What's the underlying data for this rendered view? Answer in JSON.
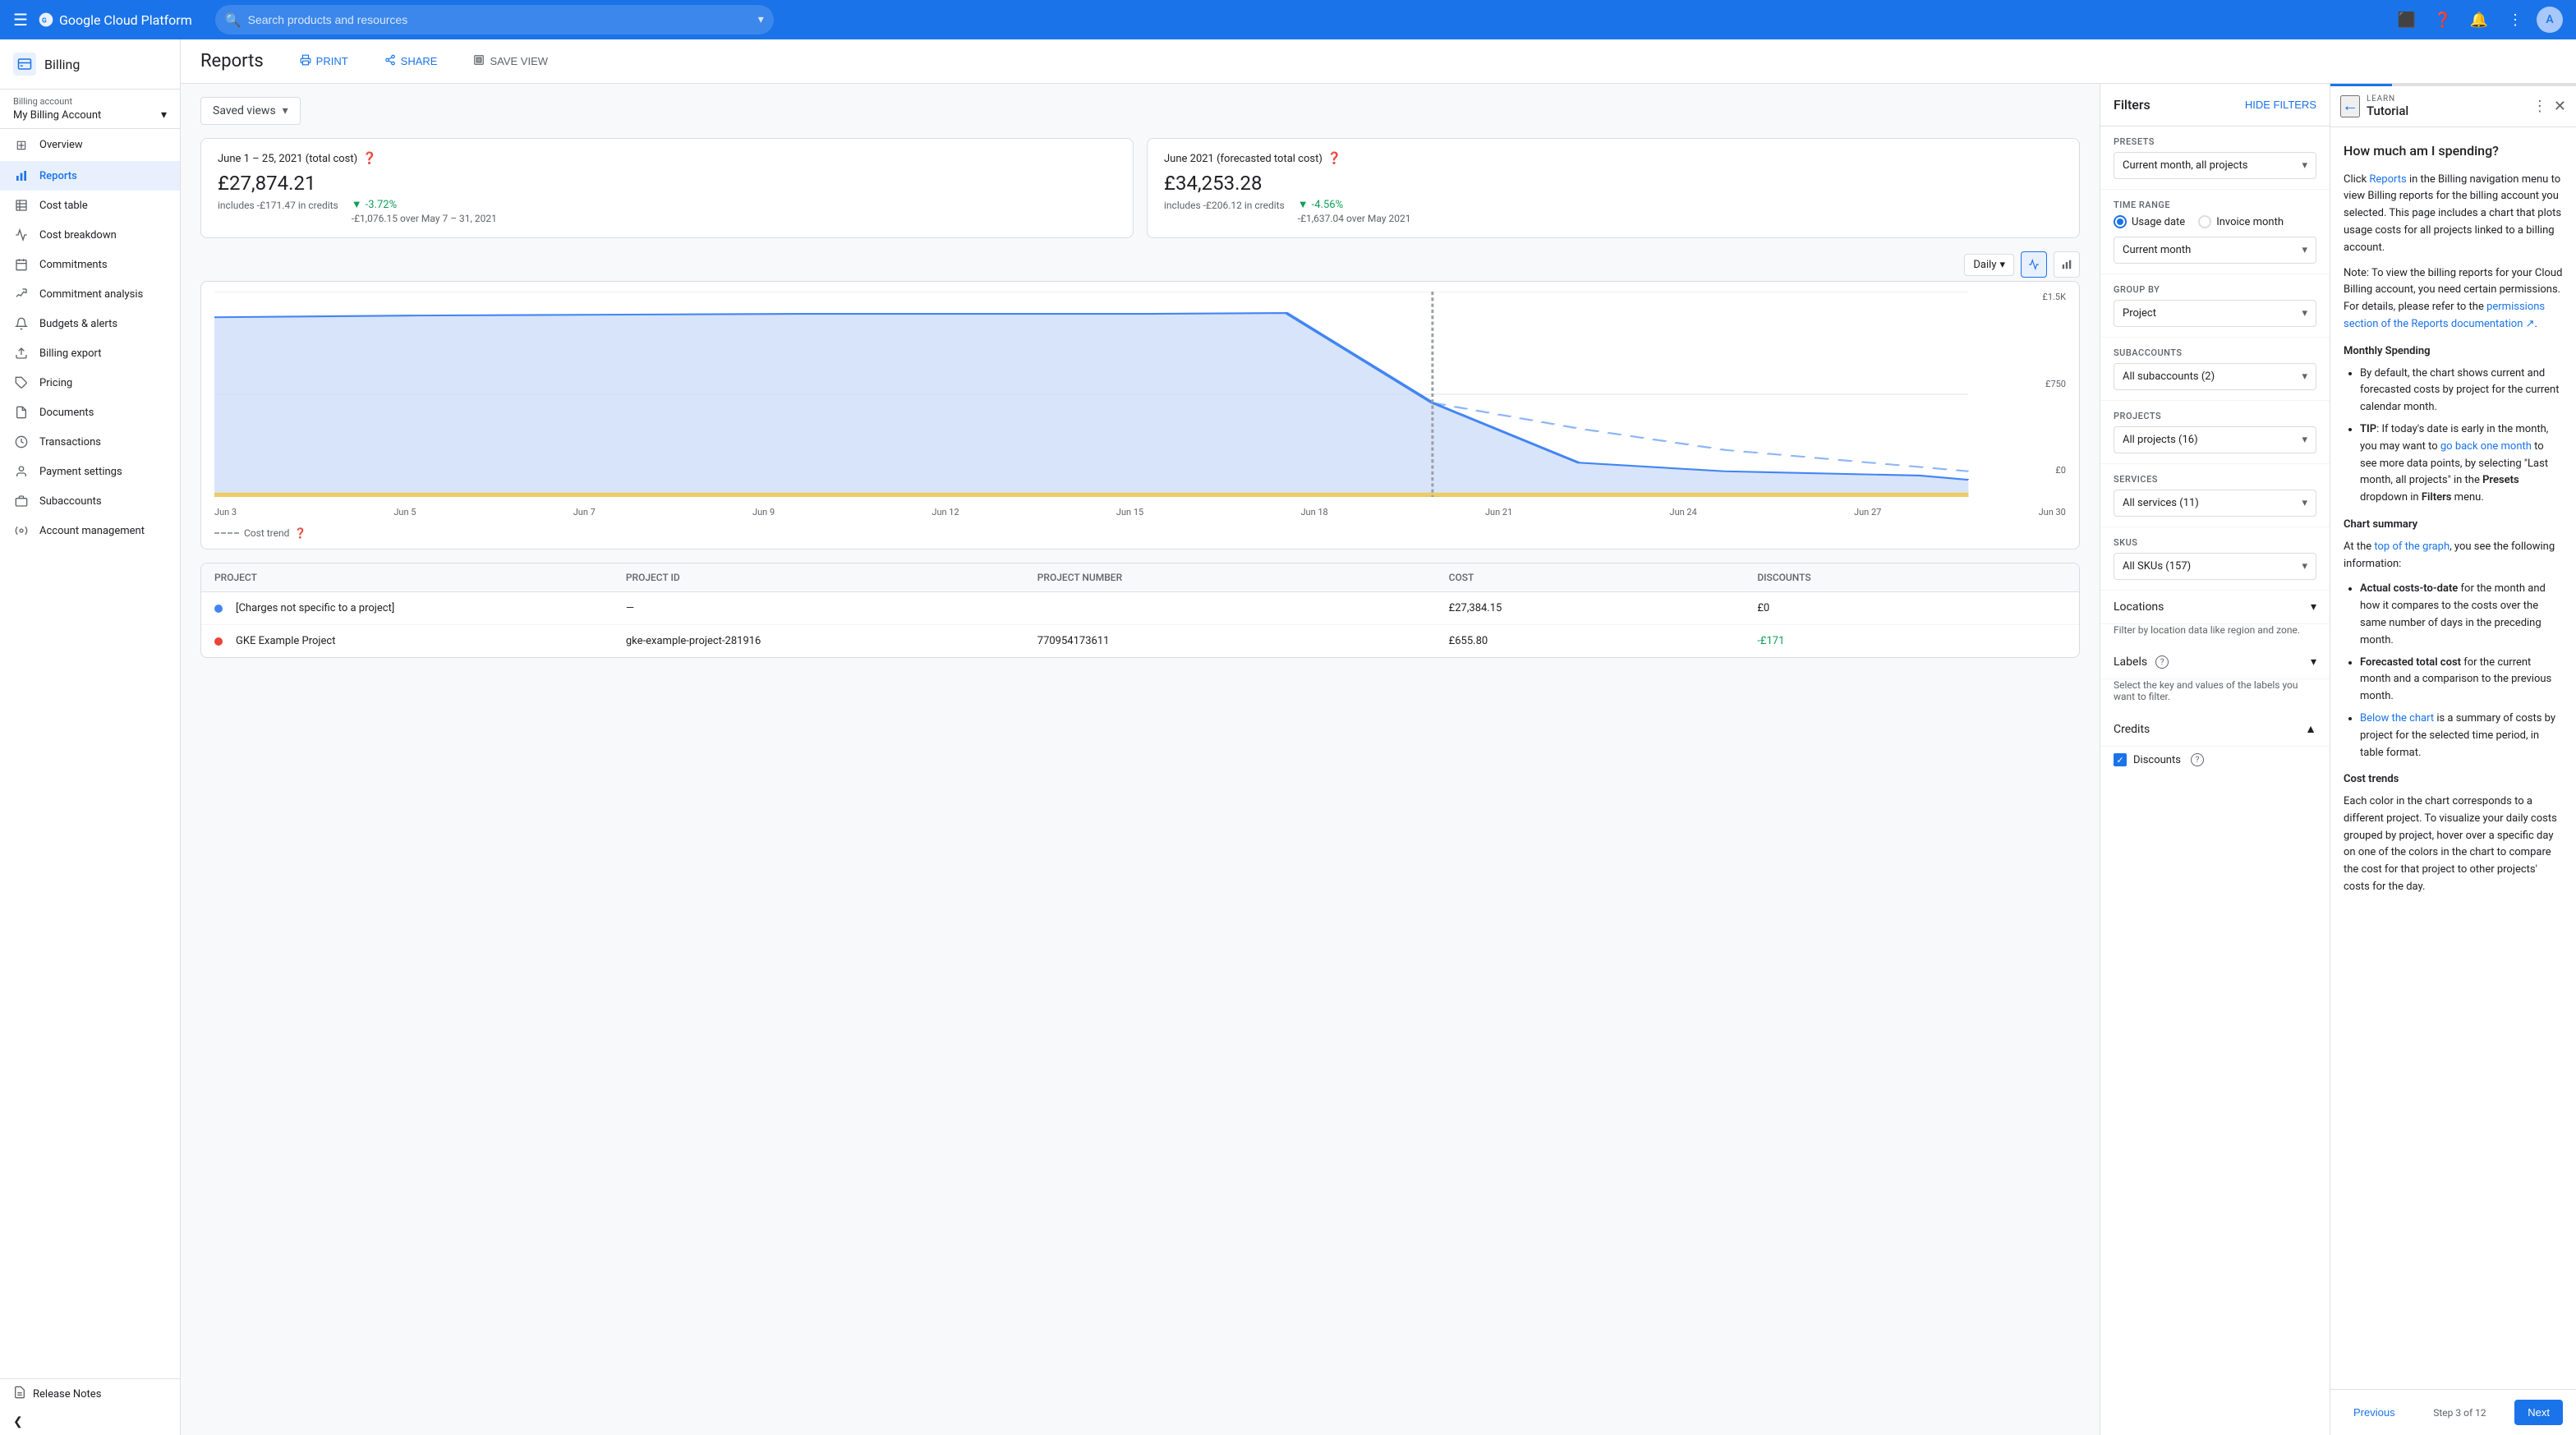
{
  "topnav": {
    "hamburger": "☰",
    "logo": "Google Cloud Platform",
    "search_placeholder": "Search products and resources",
    "avatar_initials": "A"
  },
  "sidebar": {
    "billing_icon": "▦",
    "billing_title": "Billing",
    "account_label": "Billing account",
    "account_name": "My Billing Account",
    "items": [
      {
        "id": "overview",
        "label": "Overview",
        "icon": "⊞"
      },
      {
        "id": "reports",
        "label": "Reports",
        "icon": "📊",
        "active": true
      },
      {
        "id": "cost-table",
        "label": "Cost table",
        "icon": "☰"
      },
      {
        "id": "cost-breakdown",
        "label": "Cost breakdown",
        "icon": "📉"
      },
      {
        "id": "commitments",
        "label": "Commitments",
        "icon": "📋"
      },
      {
        "id": "commitment-analysis",
        "label": "Commitment analysis",
        "icon": "📈"
      },
      {
        "id": "budgets-alerts",
        "label": "Budgets & alerts",
        "icon": "🔔"
      },
      {
        "id": "billing-export",
        "label": "Billing export",
        "icon": "⬆"
      },
      {
        "id": "pricing",
        "label": "Pricing",
        "icon": "🏷"
      },
      {
        "id": "documents",
        "label": "Documents",
        "icon": "📄"
      },
      {
        "id": "transactions",
        "label": "Transactions",
        "icon": "🕐"
      },
      {
        "id": "payment-settings",
        "label": "Payment settings",
        "icon": "👤"
      },
      {
        "id": "subaccounts",
        "label": "Subaccounts",
        "icon": "🏢"
      },
      {
        "id": "account-management",
        "label": "Account management",
        "icon": "⚙"
      }
    ],
    "footer_item": "Release Notes",
    "collapse_icon": "❮"
  },
  "reports": {
    "title": "Reports",
    "print_label": "PRINT",
    "share_label": "SHARE",
    "save_view_label": "SAVE VIEW",
    "saved_views_label": "Saved views"
  },
  "summary": {
    "card1": {
      "period": "June 1 – 25, 2021 (total cost)",
      "amount": "£27,874.21",
      "change_pct": "-3.72%",
      "credits_line": "includes -£171.47 in credits",
      "comparison": "-£1,076.15 over May 7 – 31, 2021"
    },
    "card2": {
      "period": "June 2021 (forecasted total cost)",
      "amount": "£34,253.28",
      "change_pct": "-4.56%",
      "credits_line": "includes -£206.12 in credits",
      "comparison": "-£1,637.04 over May 2021"
    }
  },
  "chart": {
    "view_label": "Daily",
    "y_labels": [
      "£1.5K",
      "£750",
      "£0"
    ],
    "x_labels": [
      "Jun 3",
      "Jun 5",
      "Jun 7",
      "Jun 9",
      "Jun 12",
      "Jun 15",
      "Jun 18",
      "Jun 21",
      "Jun 24",
      "Jun 27",
      "Jun 30"
    ],
    "cost_trend_label": "Cost trend"
  },
  "table": {
    "headers": [
      "Project",
      "Project ID",
      "Project number",
      "Cost",
      "Discounts"
    ],
    "rows": [
      {
        "color": "#4285f4",
        "name": "[Charges not specific to a project]",
        "project_id": "—",
        "project_number": "",
        "cost": "£27,384.15",
        "discount": "£0"
      },
      {
        "color": "#ea4335",
        "name": "GKE Example Project",
        "project_id": "gke-example-project-281916",
        "project_number": "770954173611",
        "cost": "£655.80",
        "discount": "-£171"
      }
    ]
  },
  "filters": {
    "title": "Filters",
    "hide_filters_label": "HIDE FILTERS",
    "presets_label": "Presets",
    "presets_value": "Current month, all projects",
    "time_range_label": "Time range",
    "usage_date_label": "Usage date",
    "invoice_month_label": "Invoice month",
    "current_month_label": "Current month",
    "group_by_label": "Group by",
    "group_by_value": "Project",
    "subaccounts_label": "Subaccounts",
    "subaccounts_value": "All subaccounts (2)",
    "projects_label": "Projects",
    "projects_value": "All projects (16)",
    "services_label": "Services",
    "services_value": "All services (11)",
    "skus_label": "SKUs",
    "skus_value": "All SKUs (157)",
    "locations_label": "Locations",
    "locations_sub": "Filter by location data like region and zone.",
    "labels_label": "Labels",
    "labels_sub": "Select the key and values of the labels you want to filter.",
    "credits_label": "Credits",
    "discounts_label": "Discounts"
  },
  "tutorial": {
    "learn_label": "LEARN",
    "title": "Tutorial",
    "heading": "How much am I spending?",
    "para1": "Click Reports in the Billing navigation menu to view Billing reports for the billing account you selected. This page includes a chart that plots usage costs for all projects linked to a billing account.",
    "para2": "Note: To view the billing reports for your Cloud Billing account, you need certain permissions. For details, please refer to the permissions section of the Reports documentation ↗.",
    "monthly_spending_title": "Monthly Spending",
    "bullet1": "By default, the chart shows current and forecasted costs by project for the current calendar month.",
    "bullet2_prefix": "TIP: If today's date is early in the month, you may want to ",
    "bullet2_link": "go back one month",
    "bullet2_suffix": " to see more data points, by selecting \"Last month, all projects\" in the Presets dropdown in Filters menu.",
    "chart_summary_title": "Chart summary",
    "chart_summary_intro": "At the top of the graph, you see the following information:",
    "chart_bullet1": "Actual costs-to-date for the month and how it compares to the costs over the same number of days in the preceding month.",
    "chart_bullet2": "Forecasted total cost for the current month and a comparison to the previous month.",
    "chart_bullet3": "Below the chart is a summary of costs by project for the selected time period, in table format.",
    "cost_trends_title": "Cost trends",
    "cost_trends_text": "Each color in the chart corresponds to a different project. To visualize your daily costs grouped by project, hover over a specific day on one of the colors in the chart to compare the cost for that project to other projects' costs for the day.",
    "prev_label": "Previous",
    "step_label": "Step 3 of 12",
    "next_label": "Next",
    "progress_pct": 25
  }
}
